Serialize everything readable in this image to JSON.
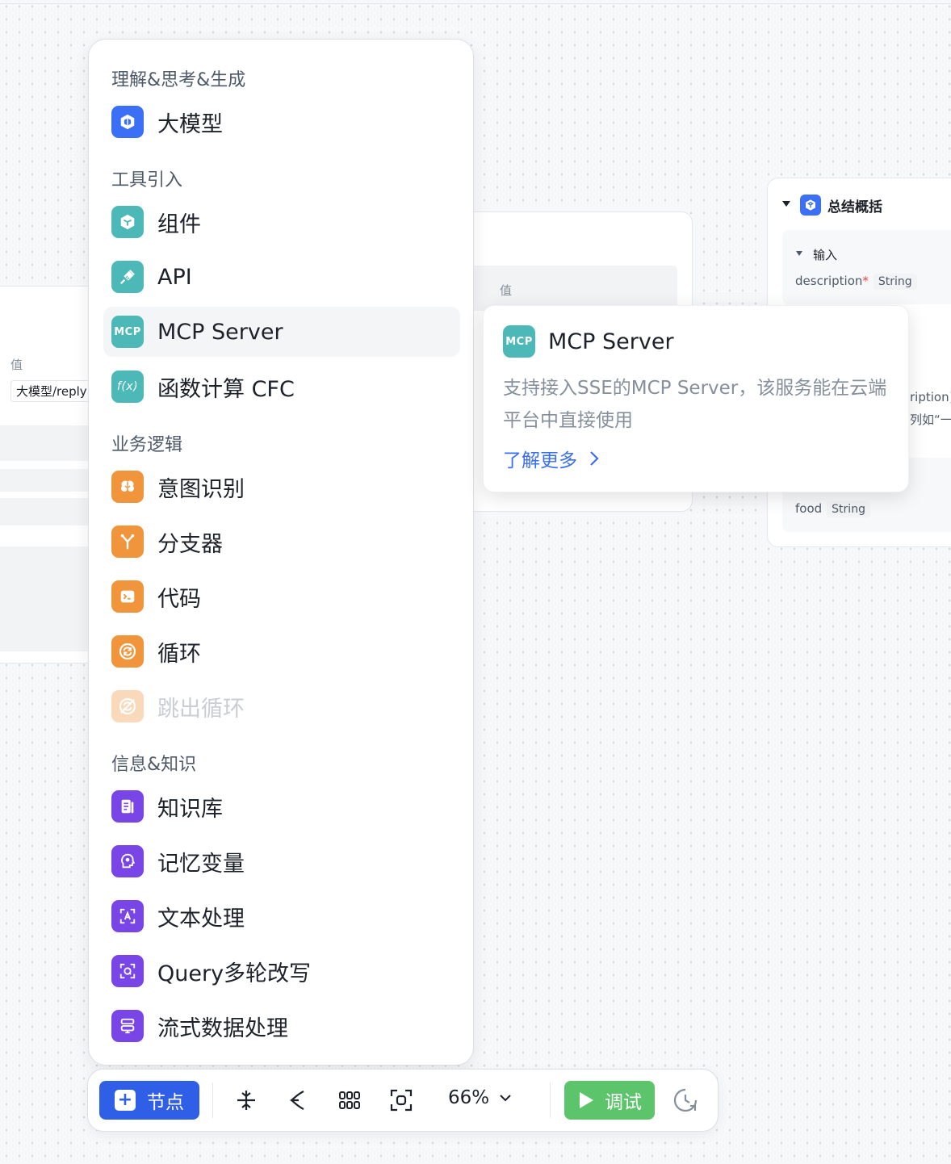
{
  "canvas": {
    "left_node": {
      "value_label": "值",
      "value": "大模型/reply"
    },
    "mid_node": {
      "value_label": "值"
    },
    "right_node": {
      "title": "总结概括",
      "input_section": "输入",
      "param_name": "description",
      "param_type": "String",
      "cut_text_1": "ription}",
      "cut_text_2": "列如“一个",
      "food_name": "food",
      "food_type": "String"
    }
  },
  "menu": {
    "categories": [
      "理解&思考&生成",
      "工具引入",
      "业务逻辑",
      "信息&知识"
    ],
    "items": [
      {
        "label": "大模型",
        "icon": "model-cube-icon"
      },
      {
        "label": "组件",
        "icon": "component-hexagon-icon"
      },
      {
        "label": "API",
        "icon": "plug-icon"
      },
      {
        "label": "MCP Server",
        "icon": "mcp-icon",
        "icon_text": "MCP"
      },
      {
        "label": "函数计算 CFC",
        "icon": "function-icon",
        "icon_text": "f(x)"
      },
      {
        "label": "意图识别",
        "icon": "brain-icon"
      },
      {
        "label": "分支器",
        "icon": "branch-icon"
      },
      {
        "label": "代码",
        "icon": "terminal-icon"
      },
      {
        "label": "循环",
        "icon": "loop-icon"
      },
      {
        "label": "跳出循环",
        "icon": "break-loop-icon"
      },
      {
        "label": "知识库",
        "icon": "knowledge-base-icon"
      },
      {
        "label": "记忆变量",
        "icon": "memory-head-icon"
      },
      {
        "label": "文本处理",
        "icon": "text-process-icon"
      },
      {
        "label": "Query多轮改写",
        "icon": "query-rewrite-icon"
      },
      {
        "label": "流式数据处理",
        "icon": "stream-data-icon"
      }
    ]
  },
  "tooltip": {
    "title": "MCP Server",
    "icon_text": "MCP",
    "body": "支持接入SSE的MCP Server，该服务能在云端平台中直接使用",
    "learn_more": "了解更多"
  },
  "toolbar": {
    "add_node_label": "节点",
    "zoom_value": "66%",
    "run_label": "调试"
  },
  "colors": {
    "blue": "#3b6ff5",
    "teal": "#4cb9b8",
    "orange": "#f0953c",
    "purple": "#7a45e6",
    "run_green": "#5cc46a",
    "link_blue": "#3a6ff0"
  }
}
